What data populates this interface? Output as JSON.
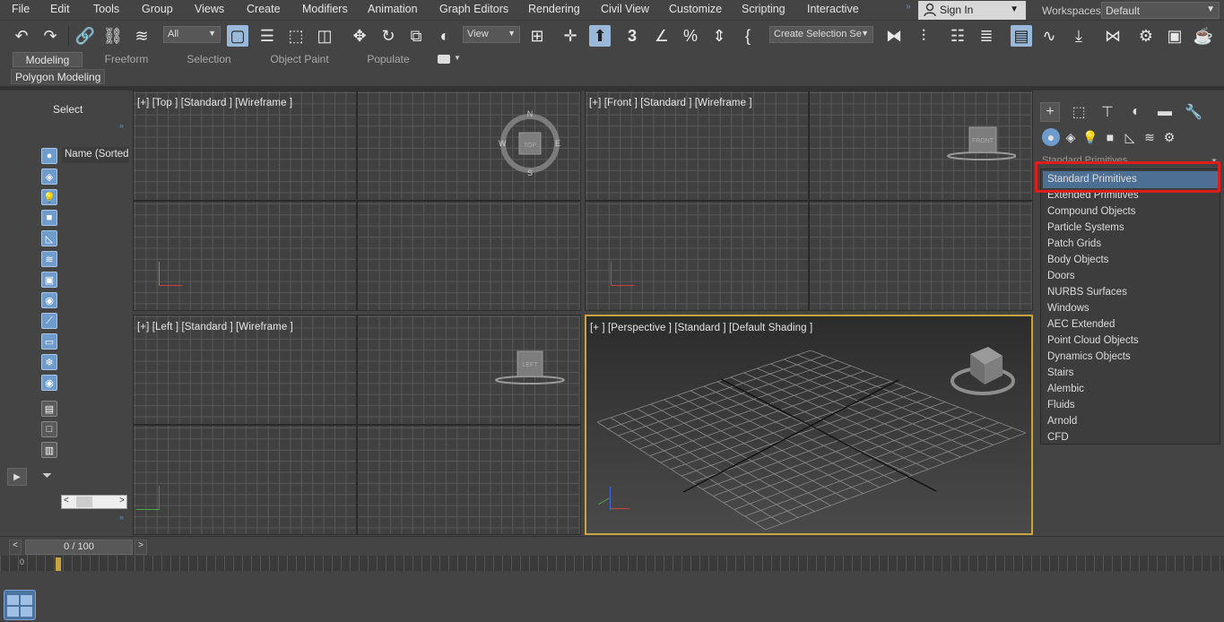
{
  "menu": {
    "items": [
      "File",
      "Edit",
      "Tools",
      "Group",
      "Views",
      "Create",
      "Modifiers",
      "Animation",
      "Graph Editors",
      "Rendering",
      "Civil View",
      "Customize",
      "Scripting",
      "Interactive"
    ],
    "sign_in": "Sign In",
    "workspaces_label": "Workspaces:",
    "workspace_value": "Default"
  },
  "toolbar": {
    "filter_value": "All",
    "view_value": "View",
    "create_selection_value": "Create Selection Se",
    "snap_label": "3"
  },
  "ribbon": {
    "tabs": [
      "Modeling",
      "Freeform",
      "Selection",
      "Object Paint",
      "Populate"
    ],
    "active_tab": "Modeling",
    "panel_label": "Polygon Modeling"
  },
  "explorer": {
    "select_label": "Select",
    "name_column": "Name (Sorted A"
  },
  "viewports": {
    "top": {
      "label": "[+] [Top ] [Standard ] [Wireframe ]",
      "cube_face": "TOP",
      "compass": [
        "N",
        "S",
        "E",
        "W"
      ]
    },
    "front": {
      "label": "[+] [Front ] [Standard ] [Wireframe ]",
      "cube_face": "FRONT"
    },
    "left": {
      "label": "[+] [Left ] [Standard ] [Wireframe ]",
      "cube_face": "LEFT"
    },
    "perspective": {
      "label": "[+ ] [Perspective ] [Standard ] [Default Shading ]"
    }
  },
  "command_panel": {
    "dropdown_current": "Standard Primitives",
    "dropdown_options": [
      "Standard Primitives",
      "Extended Primitives",
      "Compound Objects",
      "Particle Systems",
      "Patch Grids",
      "Body Objects",
      "Doors",
      "NURBS Surfaces",
      "Windows",
      "AEC Extended",
      "Point Cloud Objects",
      "Dynamics Objects",
      "Stairs",
      "Alembic",
      "Fluids",
      "Arnold",
      "CFD"
    ],
    "highlighted_option": "Standard Primitives"
  },
  "timeline": {
    "frame_display": "0 / 100",
    "track_start": "0"
  },
  "colors": {
    "highlight_red": "#e01d1d",
    "active_viewport": "#c8a43c",
    "selection_blue": "#4e6f94"
  }
}
